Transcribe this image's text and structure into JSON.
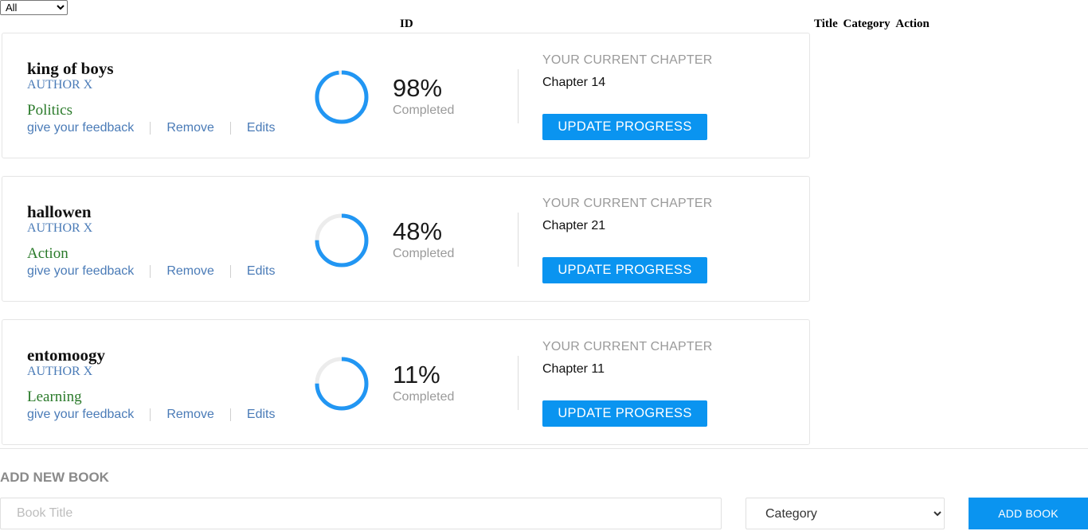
{
  "filter": {
    "selected": "All",
    "options": [
      "All"
    ]
  },
  "table_header": {
    "id": "ID",
    "title": "Title",
    "category": "Category",
    "action": "Action"
  },
  "books": [
    {
      "title": "king of boys",
      "author": "AUTHOR X",
      "category": "Politics",
      "links": {
        "feedback": "give your feedback",
        "remove": "Remove",
        "edit": "Edits"
      },
      "progress": 98,
      "progress_label": "98%",
      "completed_label": "Completed",
      "current_chapter_label": "YOUR CURRENT CHAPTER",
      "chapter": "Chapter 14",
      "update_label": "UPDATE PROGRESS"
    },
    {
      "title": "hallowen",
      "author": "AUTHOR X",
      "category": "Action",
      "links": {
        "feedback": "give your feedback",
        "remove": "Remove",
        "edit": "Edits"
      },
      "progress": 48,
      "progress_label": "48%",
      "completed_label": "Completed",
      "current_chapter_label": "YOUR CURRENT CHAPTER",
      "chapter": "Chapter 21",
      "update_label": "UPDATE PROGRESS"
    },
    {
      "title": "entomoogy",
      "author": "AUTHOR X",
      "category": "Learning",
      "links": {
        "feedback": "give your feedback",
        "remove": "Remove",
        "edit": "Edits"
      },
      "progress": 11,
      "progress_label": "11%",
      "completed_label": "Completed",
      "current_chapter_label": "YOUR CURRENT CHAPTER",
      "chapter": "Chapter 11",
      "update_label": "UPDATE PROGRESS"
    }
  ],
  "add_book": {
    "heading": "ADD NEW BOOK",
    "title_placeholder": "Book Title",
    "category_selected": "Category",
    "button_label": "ADD BOOK"
  },
  "colors": {
    "accent": "#0a94f0",
    "ring": "#2196f3",
    "ring_track": "#ececec",
    "link": "#4a7bb7",
    "category": "#2a7a2a",
    "muted": "#9a9a9a"
  }
}
